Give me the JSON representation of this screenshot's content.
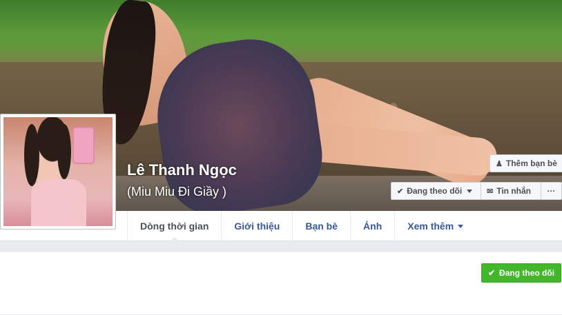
{
  "profile": {
    "name": "Lê Thanh Ngọc",
    "alternate_name": "(Miu Miu Đi Giầy )"
  },
  "cover_actions": {
    "add_friend_label": "Thêm bạn bè",
    "following_label": "Đang theo dõi",
    "message_label": "Tin nhắn",
    "more_label": "···"
  },
  "nav": {
    "tabs": [
      {
        "label": "Dòng thời gian"
      },
      {
        "label": "Giới thiệu"
      },
      {
        "label": "Bạn bè"
      },
      {
        "label": "Ảnh"
      },
      {
        "label": "Xem thêm"
      }
    ]
  },
  "content": {
    "follow_button_label": "Đang theo dõi"
  },
  "colors": {
    "link_blue": "#365899",
    "follow_green": "#42b72a",
    "page_bg": "#e9ebee"
  }
}
